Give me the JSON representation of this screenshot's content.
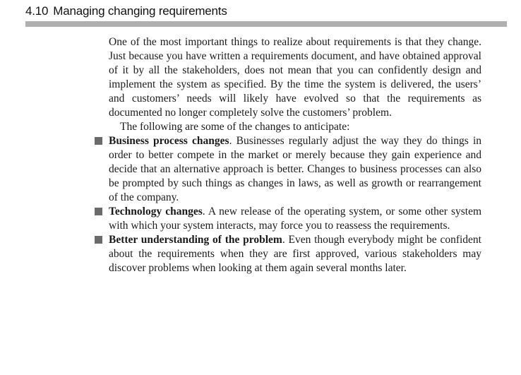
{
  "section": {
    "number": "4.10",
    "title": "Managing changing requirements"
  },
  "intro": {
    "paragraph": "One of the most important things to realize about requirements is that they change. Just because you have written a requirements document, and have obtained approval of it by all the stakeholders, does not mean that you can confidently design and implement the system as specified. By the time the system is delivered, the users’ and customers’ needs will likely have evolved so that the requirements as documented no longer completely solve the customers’ problem.",
    "lead_in": "The following are some of the changes to anticipate:"
  },
  "bullets": [
    {
      "term": "Business process changes",
      "text": ". Businesses regularly adjust the way they do things in order to better compete in the market or merely because they gain experience and decide that an alternative approach is better. Changes to business processes can also be prompted by such things as changes in laws, as well as growth or rearrangement of the company."
    },
    {
      "term": "Technology changes",
      "text": ". A new release of the operating system, or some other system with which your system interacts, may force you to reassess the requirements."
    },
    {
      "term": "Better understanding of the problem",
      "text": ". Even though everybody might be confident about the requirements when they are first approved, various stakeholders may discover problems when looking at them again several months later."
    }
  ]
}
